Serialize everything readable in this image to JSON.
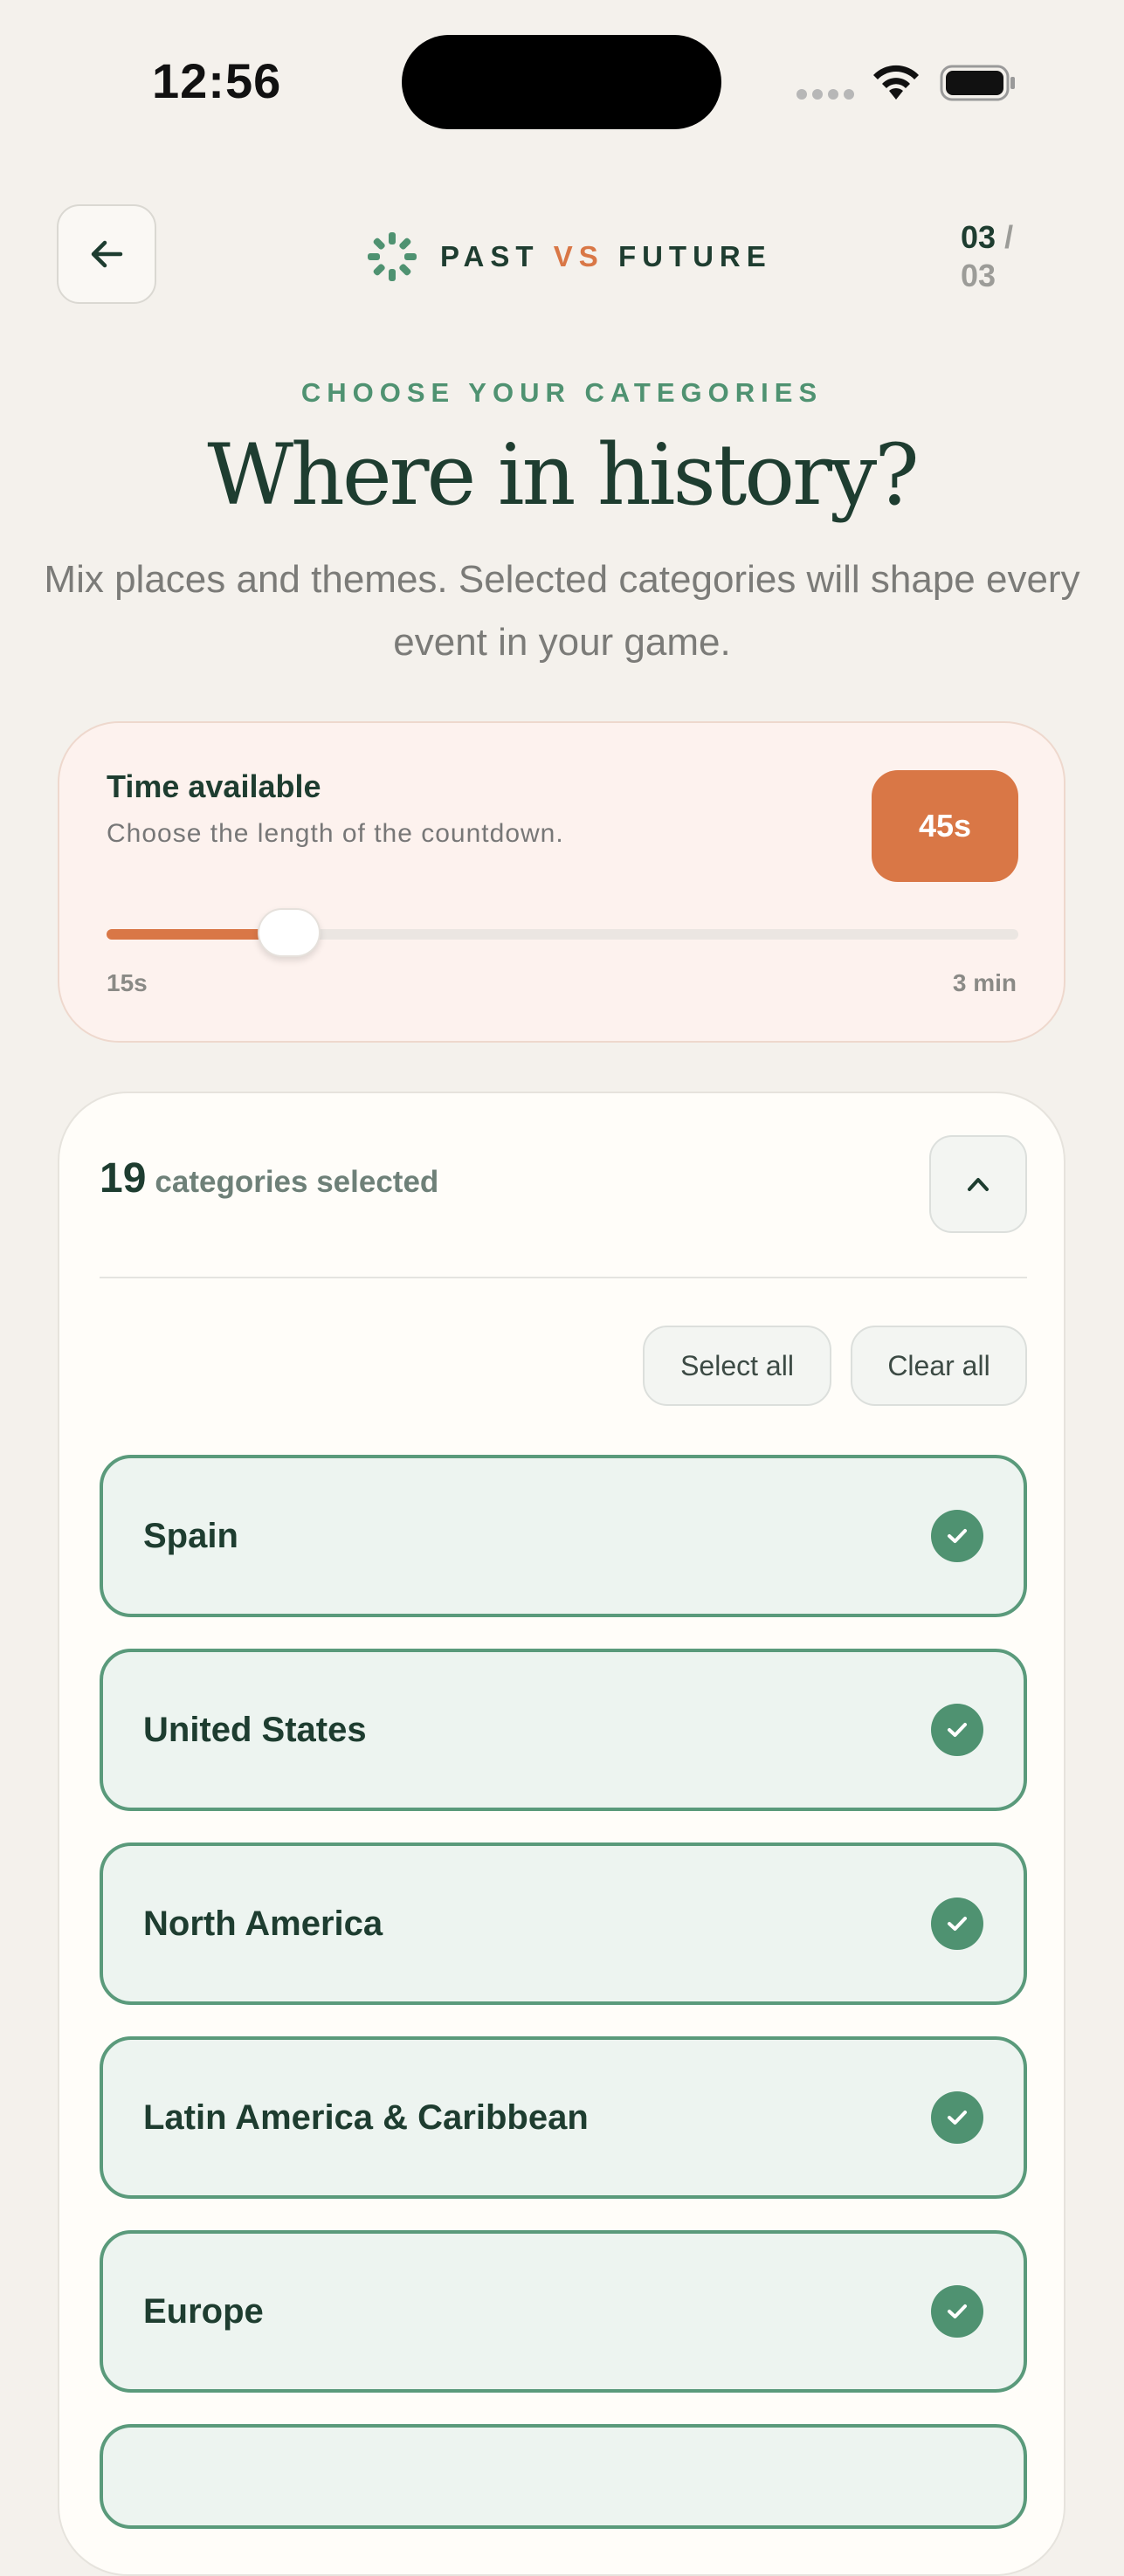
{
  "status_bar": {
    "time": "12:56"
  },
  "header": {
    "brand": {
      "part1": "PAST",
      "vs": "VS",
      "part2": "FUTURE"
    },
    "step": {
      "current": "03",
      "separator": "/",
      "total": "03"
    }
  },
  "intro": {
    "eyebrow": "CHOOSE YOUR CATEGORIES",
    "title": "Where in history?",
    "subtitle": "Mix places and themes. Selected categories will shape every event in your game."
  },
  "timer": {
    "title": "Time available",
    "description": "Choose the length of the countdown.",
    "value_label": "45s",
    "min_label": "15s",
    "max_label": "3 min",
    "slider_fraction": 0.2,
    "accent_color": "#d97746"
  },
  "categories": {
    "selected_count": "19",
    "selected_label": "categories selected",
    "select_all_label": "Select all",
    "clear_all_label": "Clear all",
    "items": [
      {
        "label": "Spain",
        "selected": true
      },
      {
        "label": "United States",
        "selected": true
      },
      {
        "label": "North America",
        "selected": true
      },
      {
        "label": "Latin America & Caribbean",
        "selected": true
      },
      {
        "label": "Europe",
        "selected": true
      }
    ],
    "accent_color": "#4f9271"
  }
}
